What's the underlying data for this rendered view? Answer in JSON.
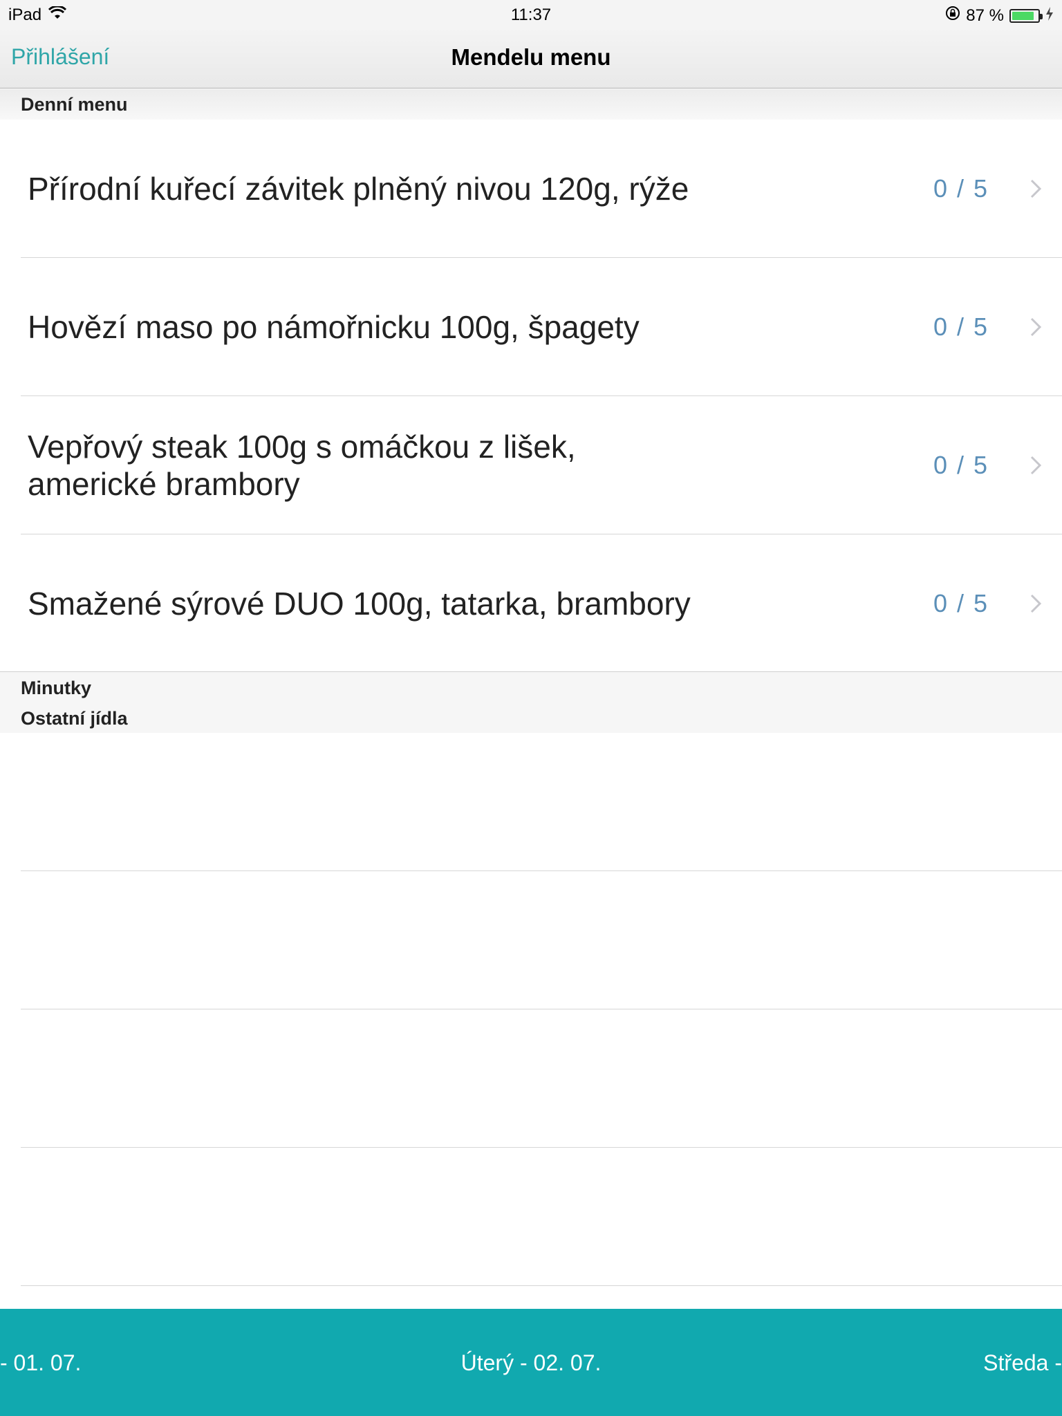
{
  "status_bar": {
    "device": "iPad",
    "time": "11:37",
    "battery": "87 %",
    "battery_level": 0.87,
    "icons": [
      "wifi-icon",
      "rotation-lock-icon",
      "battery-icon",
      "charging-bolt-icon"
    ]
  },
  "nav": {
    "back_label": "Přihlášení",
    "title": "Mendelu menu"
  },
  "sections": {
    "daily": "Denní menu",
    "minutky": "Minutky",
    "other": "Ostatní jídla"
  },
  "daily_items": [
    {
      "title": "Přírodní kuřecí závitek plněný nivou 120g, rýže",
      "rating": "0 / 5"
    },
    {
      "title": "Hovězí maso po námořnicku 100g, špagety",
      "rating": "0 / 5"
    },
    {
      "title": "Vepřový steak 100g s omáčkou z lišek, americké brambory",
      "rating": "0 / 5"
    },
    {
      "title": "Smažené sýrové DUO 100g, tatarka, brambory",
      "rating": "0 / 5"
    }
  ],
  "days": {
    "prev": "- 01. 07.",
    "current": "Úterý - 02. 07.",
    "next": "Středa -"
  },
  "colors": {
    "accent": "#11a9af",
    "back_link": "#2fa6a8",
    "rating": "#5b8fb8"
  }
}
